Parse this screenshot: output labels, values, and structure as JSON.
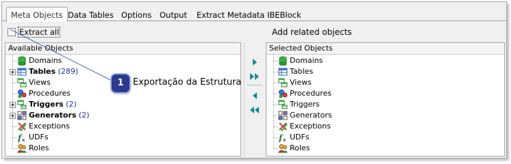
{
  "tabs": [
    {
      "label": "Meta Objects",
      "active": true
    },
    {
      "label": "Data Tables",
      "active": false
    },
    {
      "label": "Options",
      "active": false
    },
    {
      "label": "Output",
      "active": false
    },
    {
      "label": "Extract Metadata IBEBlock",
      "active": false
    }
  ],
  "extract_all": {
    "label": "Extract all",
    "checked": false
  },
  "add_related": {
    "label": "Add related objects"
  },
  "available": {
    "header": "Available Objects",
    "items": [
      {
        "name": "Domains",
        "icon": "domains-icon",
        "bold": false,
        "expandable": false
      },
      {
        "name": "Tables",
        "count": "(289)",
        "icon": "tables-icon",
        "bold": true,
        "expandable": true
      },
      {
        "name": "Views",
        "icon": "views-icon",
        "bold": false,
        "expandable": false
      },
      {
        "name": "Procedures",
        "icon": "procedures-icon",
        "bold": false,
        "expandable": false
      },
      {
        "name": "Triggers",
        "count": "(2)",
        "icon": "triggers-icon",
        "bold": true,
        "expandable": true
      },
      {
        "name": "Generators",
        "count": "(2)",
        "icon": "generators-icon",
        "bold": true,
        "expandable": true
      },
      {
        "name": "Exceptions",
        "icon": "exceptions-icon",
        "bold": false,
        "expandable": false
      },
      {
        "name": "UDFs",
        "icon": "udfs-icon",
        "bold": false,
        "expandable": false
      },
      {
        "name": "Roles",
        "icon": "roles-icon",
        "bold": false,
        "expandable": false
      }
    ]
  },
  "selected": {
    "header": "Selected Objects",
    "items": [
      {
        "name": "Domains",
        "icon": "domains-icon"
      },
      {
        "name": "Tables",
        "icon": "tables-icon"
      },
      {
        "name": "Views",
        "icon": "views-icon"
      },
      {
        "name": "Procedures",
        "icon": "procedures-icon"
      },
      {
        "name": "Triggers",
        "icon": "triggers-icon"
      },
      {
        "name": "Generators",
        "icon": "generators-icon"
      },
      {
        "name": "Exceptions",
        "icon": "exceptions-icon"
      },
      {
        "name": "UDFs",
        "icon": "udfs-icon"
      },
      {
        "name": "Roles",
        "icon": "roles-icon"
      }
    ]
  },
  "buttons": {
    "add": {
      "icon": "arrow-right-icon"
    },
    "add_all": {
      "icon": "double-arrow-right-icon"
    },
    "remove": {
      "icon": "arrow-left-icon"
    },
    "remove_all": {
      "icon": "double-arrow-left-icon"
    }
  },
  "callout": {
    "number": "1",
    "text": "Exportação da Estrutura"
  },
  "colors": {
    "accent": "#2b3c8e",
    "arrow": "#0e8a8a",
    "count": "#1a2fb0"
  }
}
